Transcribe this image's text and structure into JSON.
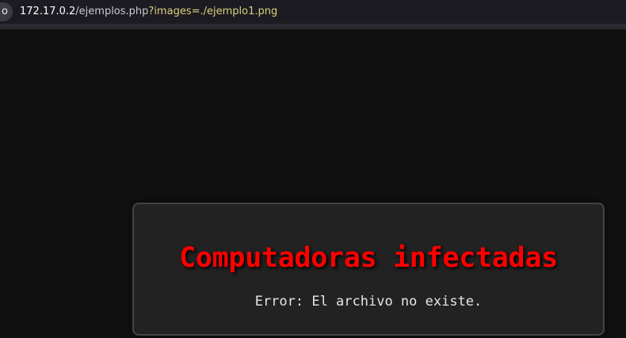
{
  "browser": {
    "site_label": "o",
    "url_host": "172.17.0.2",
    "url_path": "/ejemplos.php",
    "url_query": "?images=./ejemplo1.png"
  },
  "page": {
    "title": "Computadoras infectadas",
    "message": "Error: El archivo no existe."
  },
  "colors": {
    "title": "#ff0000",
    "card_background": "#222222",
    "page_background": "#111111"
  }
}
